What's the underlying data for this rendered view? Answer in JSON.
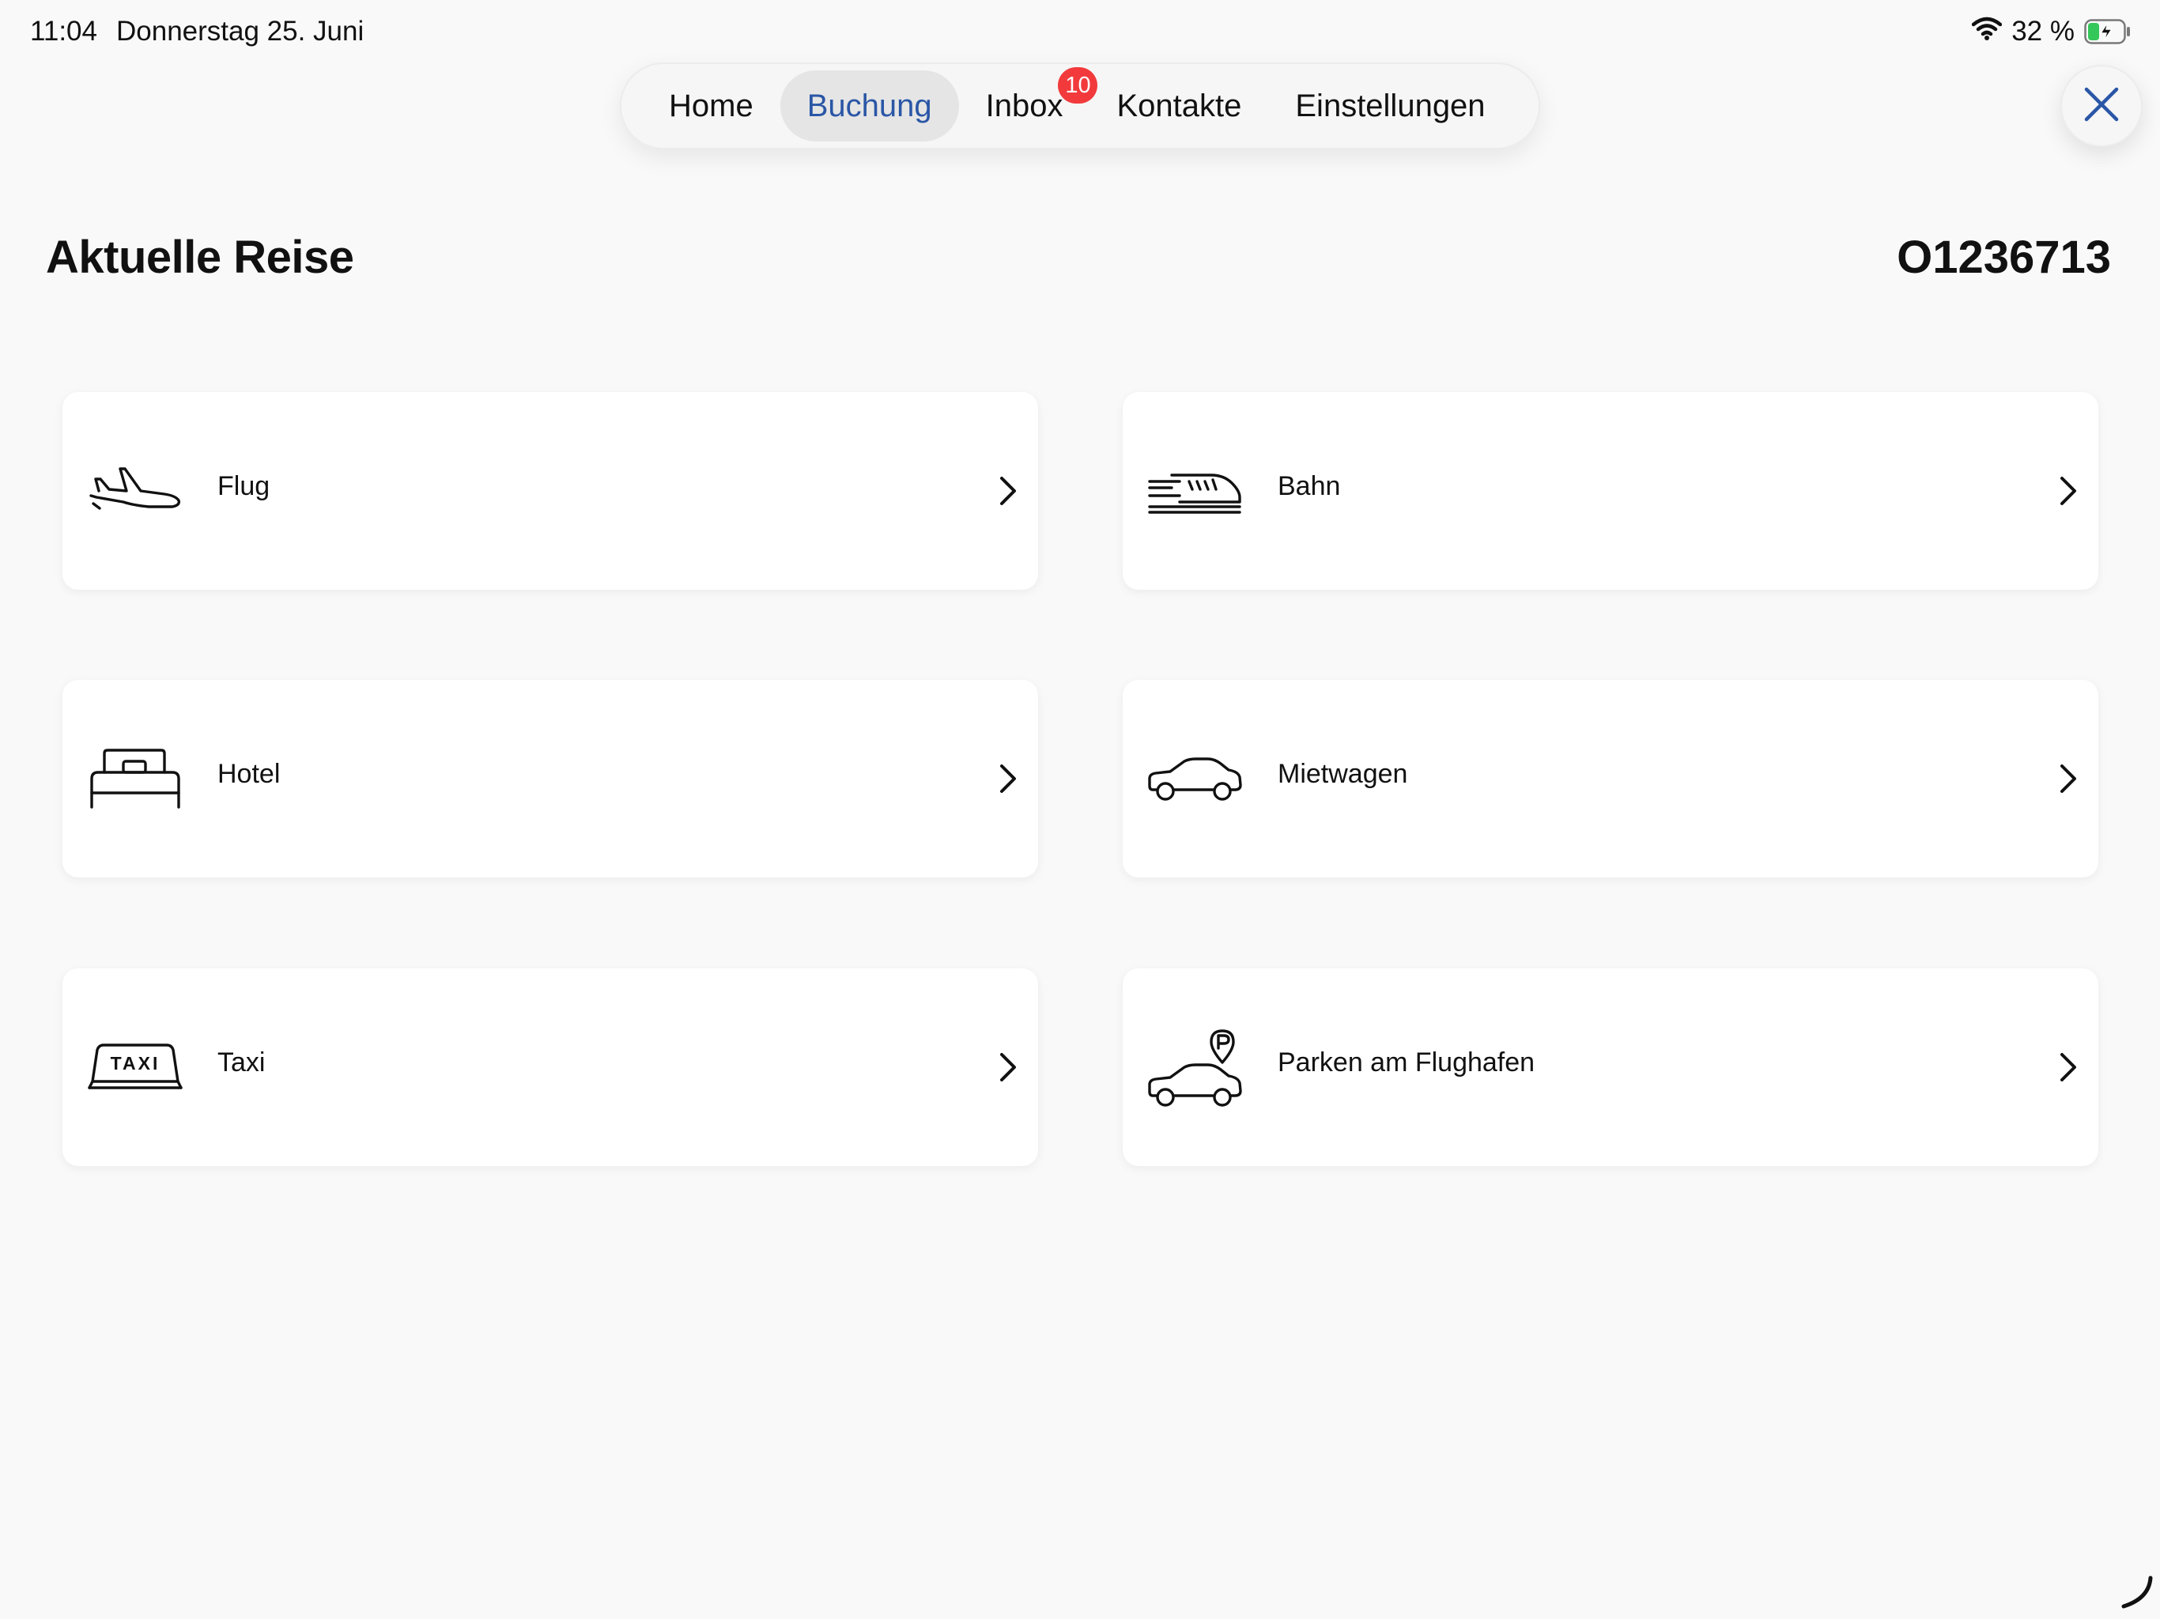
{
  "status_bar": {
    "time": "11:04",
    "date": "Donnerstag 25. Juni",
    "battery_percent": "32 %",
    "battery_level": 0.32,
    "charging": true
  },
  "nav": {
    "tabs": [
      {
        "label": "Home",
        "active": false
      },
      {
        "label": "Buchung",
        "active": true
      },
      {
        "label": "Inbox",
        "active": false,
        "badge": "10"
      },
      {
        "label": "Kontakte",
        "active": false
      },
      {
        "label": "Einstellungen",
        "active": false
      }
    ]
  },
  "header": {
    "title": "Aktuelle Reise",
    "booking_number": "O1236713"
  },
  "categories": [
    {
      "label": "Flug",
      "icon": "airplane-icon"
    },
    {
      "label": "Bahn",
      "icon": "train-icon"
    },
    {
      "label": "Hotel",
      "icon": "bed-icon"
    },
    {
      "label": "Mietwagen",
      "icon": "car-icon"
    },
    {
      "label": "Taxi",
      "icon": "taxi-icon"
    },
    {
      "label": "Parken am Flughafen",
      "icon": "parking-car-icon"
    }
  ],
  "colors": {
    "accent": "#2a56a6",
    "badge": "#f23a3c",
    "background": "#f9f9f9",
    "card": "#ffffff",
    "battery_charging": "#34c759"
  }
}
